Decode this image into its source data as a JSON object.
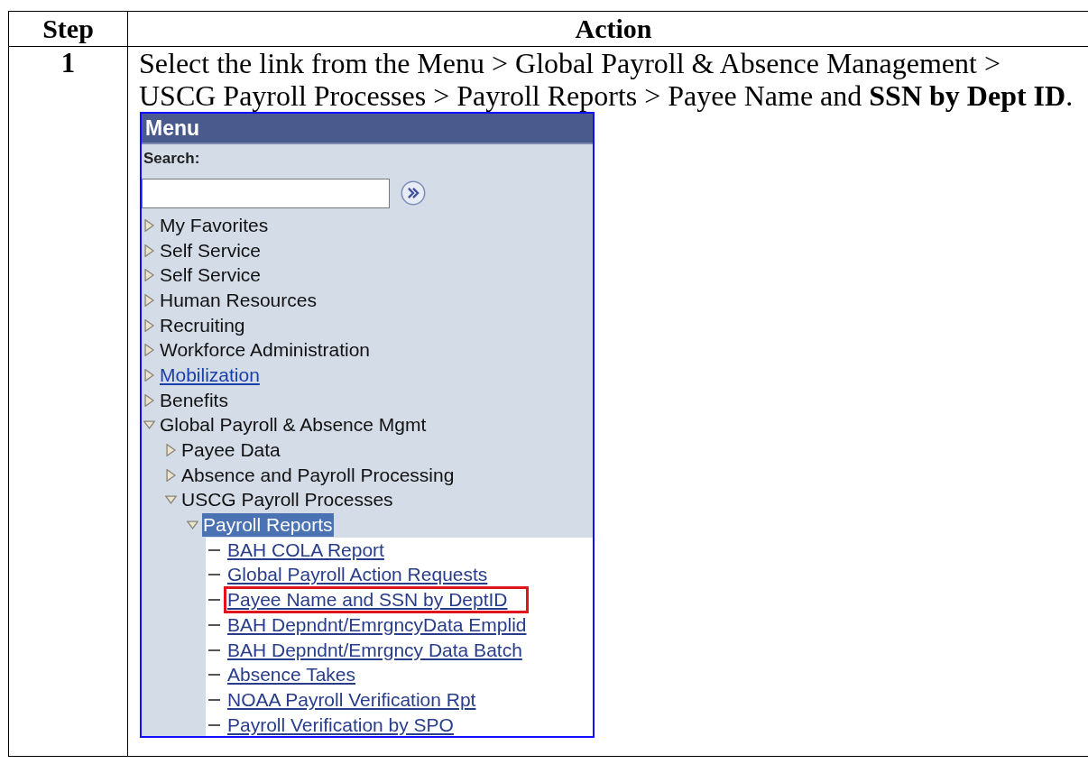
{
  "table": {
    "columns": [
      "Step",
      "Action"
    ],
    "rows": [
      {
        "step": "1",
        "instruction": "Select the link from the Menu > Global Payroll & Absence Management > USCG Payroll Processes > Payroll Reports > Payee Name and **SSN by Dept ID**.",
        "menu": {
          "title": "Menu",
          "search_label": "Search:",
          "items": [
            {
              "label": "My Favorites",
              "kind": "folder",
              "expanded": false,
              "selected": false,
              "link": false
            },
            {
              "label": "Self Service",
              "kind": "folder",
              "expanded": false,
              "selected": false,
              "link": false
            },
            {
              "label": "Self Service",
              "kind": "folder",
              "expanded": false,
              "selected": false,
              "link": false
            },
            {
              "label": "Human Resources",
              "kind": "folder",
              "expanded": false,
              "selected": false,
              "link": false
            },
            {
              "label": "Recruiting",
              "kind": "folder",
              "expanded": false,
              "selected": false,
              "link": false
            },
            {
              "label": "Workforce Administration",
              "kind": "folder",
              "expanded": false,
              "selected": false,
              "link": false
            },
            {
              "label": "Mobilization",
              "kind": "folder",
              "expanded": false,
              "selected": false,
              "link": true
            },
            {
              "label": "Benefits",
              "kind": "folder",
              "expanded": false,
              "selected": false,
              "link": false
            },
            {
              "label": "Global Payroll & Absence Mgmt",
              "kind": "folder",
              "expanded": true,
              "selected": false,
              "link": false,
              "children": [
                {
                  "label": "Payee Data",
                  "kind": "folder",
                  "expanded": false,
                  "selected": false,
                  "link": false
                },
                {
                  "label": "Absence and Payroll Processing",
                  "kind": "folder",
                  "expanded": false,
                  "selected": false,
                  "link": false
                },
                {
                  "label": "USCG Payroll Processes",
                  "kind": "folder",
                  "expanded": true,
                  "selected": false,
                  "link": false,
                  "children": [
                    {
                      "label": "Payroll Reports",
                      "kind": "folder",
                      "expanded": true,
                      "selected": true,
                      "link": false,
                      "children": [
                        {
                          "label": "BAH COLA Report",
                          "kind": "page",
                          "outlined": false
                        },
                        {
                          "label": "Global Payroll Action Requests",
                          "kind": "page",
                          "outlined": false
                        },
                        {
                          "label": "Payee Name and SSN by DeptID",
                          "kind": "page",
                          "outlined": true
                        },
                        {
                          "label": "BAH Depndnt/EmrgncyData Emplid",
                          "kind": "page",
                          "outlined": false
                        },
                        {
                          "label": "BAH Depndnt/Emrgncy Data Batch",
                          "kind": "page",
                          "outlined": false
                        },
                        {
                          "label": "Absence Takes",
                          "kind": "page",
                          "outlined": false
                        },
                        {
                          "label": "NOAA Payroll Verification Rpt",
                          "kind": "page",
                          "outlined": false
                        },
                        {
                          "label": "Payroll Verification by SPO",
                          "kind": "page",
                          "outlined": false
                        }
                      ]
                    }
                  ]
                }
              ]
            }
          ]
        }
      }
    ]
  }
}
